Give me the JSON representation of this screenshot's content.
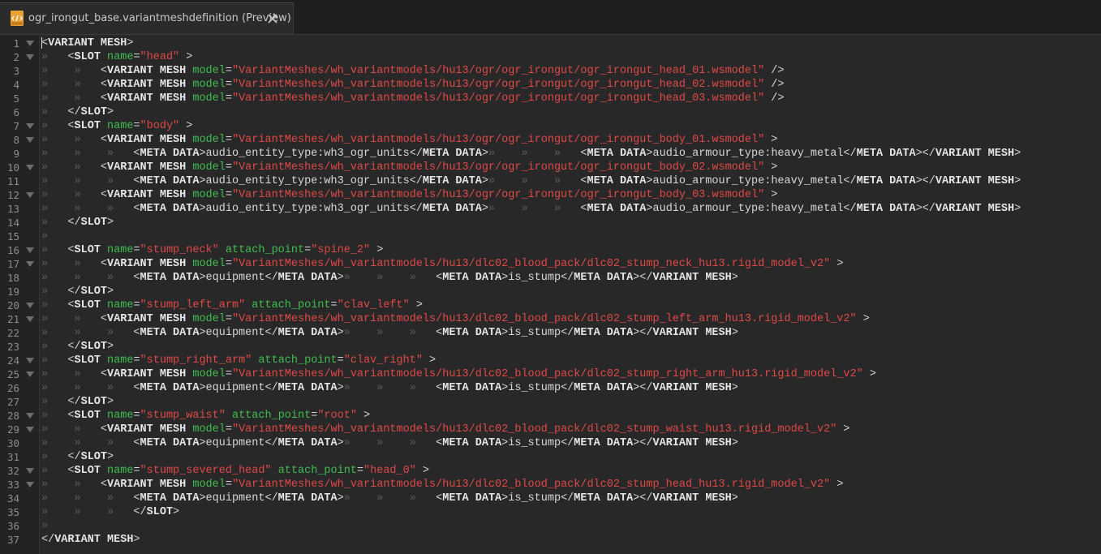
{
  "tab": {
    "title": "ogr_irongut_base.variantmeshdefinition (Preview)",
    "close_icon": "pin-close-icon",
    "file_icon": "xml-file-icon"
  },
  "colors": {
    "tag": "#e6e6e6",
    "attr": "#3fbe52",
    "string": "#e04848",
    "indent_marker": "#5c5c5c",
    "line_number": "#8c8c8c"
  },
  "lines": [
    {
      "n": "1",
      "fold": true,
      "indent": 0,
      "segs": [
        [
          "p",
          "<"
        ],
        [
          "t",
          "VARIANT MESH"
        ],
        [
          "p",
          ">"
        ]
      ]
    },
    {
      "n": "2",
      "fold": true,
      "indent": 1,
      "segs": [
        [
          "p",
          "<"
        ],
        [
          "t",
          "SLOT "
        ],
        [
          "a",
          "name"
        ],
        [
          "p",
          "="
        ],
        [
          "s",
          "\"head\""
        ],
        [
          "p",
          " >"
        ]
      ]
    },
    {
      "n": "3",
      "fold": false,
      "indent": 2,
      "segs": [
        [
          "p",
          "<"
        ],
        [
          "t",
          "VARIANT MESH "
        ],
        [
          "a",
          "model"
        ],
        [
          "p",
          "="
        ],
        [
          "s",
          "\"VariantMeshes/wh_variantmodels/hu13/ogr/ogr_irongut/ogr_irongut_head_01.wsmodel\""
        ],
        [
          "p",
          " />"
        ]
      ]
    },
    {
      "n": "4",
      "fold": false,
      "indent": 2,
      "segs": [
        [
          "p",
          "<"
        ],
        [
          "t",
          "VARIANT MESH "
        ],
        [
          "a",
          "model"
        ],
        [
          "p",
          "="
        ],
        [
          "s",
          "\"VariantMeshes/wh_variantmodels/hu13/ogr/ogr_irongut/ogr_irongut_head_02.wsmodel\""
        ],
        [
          "p",
          " />"
        ]
      ]
    },
    {
      "n": "5",
      "fold": false,
      "indent": 2,
      "segs": [
        [
          "p",
          "<"
        ],
        [
          "t",
          "VARIANT MESH "
        ],
        [
          "a",
          "model"
        ],
        [
          "p",
          "="
        ],
        [
          "s",
          "\"VariantMeshes/wh_variantmodels/hu13/ogr/ogr_irongut/ogr_irongut_head_03.wsmodel\""
        ],
        [
          "p",
          " />"
        ]
      ]
    },
    {
      "n": "6",
      "fold": false,
      "indent": 1,
      "segs": [
        [
          "p",
          "</"
        ],
        [
          "t",
          "SLOT"
        ],
        [
          "p",
          ">"
        ]
      ]
    },
    {
      "n": "7",
      "fold": true,
      "indent": 1,
      "segs": [
        [
          "p",
          "<"
        ],
        [
          "t",
          "SLOT "
        ],
        [
          "a",
          "name"
        ],
        [
          "p",
          "="
        ],
        [
          "s",
          "\"body\""
        ],
        [
          "p",
          " >"
        ]
      ]
    },
    {
      "n": "8",
      "fold": true,
      "indent": 2,
      "segs": [
        [
          "p",
          "<"
        ],
        [
          "t",
          "VARIANT MESH "
        ],
        [
          "a",
          "model"
        ],
        [
          "p",
          "="
        ],
        [
          "s",
          "\"VariantMeshes/wh_variantmodels/hu13/ogr/ogr_irongut/ogr_irongut_body_01.wsmodel\""
        ],
        [
          "p",
          " >"
        ]
      ]
    },
    {
      "n": "9",
      "fold": false,
      "indent": 3,
      "segs": [
        [
          "p",
          "<"
        ],
        [
          "t",
          "META DATA"
        ],
        [
          "p",
          ">audio_entity_type:wh3_ogr_units</"
        ],
        [
          "t",
          "META DATA"
        ],
        [
          "p",
          ">"
        ],
        [
          "ind",
          "»    »    »   "
        ],
        [
          "p",
          "<"
        ],
        [
          "t",
          "META DATA"
        ],
        [
          "p",
          ">audio_armour_type:heavy_metal</"
        ],
        [
          "t",
          "META DATA"
        ],
        [
          "p",
          "></"
        ],
        [
          "t",
          "VARIANT MESH"
        ],
        [
          "p",
          ">"
        ]
      ]
    },
    {
      "n": "10",
      "fold": true,
      "indent": 2,
      "segs": [
        [
          "p",
          "<"
        ],
        [
          "t",
          "VARIANT MESH "
        ],
        [
          "a",
          "model"
        ],
        [
          "p",
          "="
        ],
        [
          "s",
          "\"VariantMeshes/wh_variantmodels/hu13/ogr/ogr_irongut/ogr_irongut_body_02.wsmodel\""
        ],
        [
          "p",
          " >"
        ]
      ]
    },
    {
      "n": "11",
      "fold": false,
      "indent": 3,
      "segs": [
        [
          "p",
          "<"
        ],
        [
          "t",
          "META DATA"
        ],
        [
          "p",
          ">audio_entity_type:wh3_ogr_units</"
        ],
        [
          "t",
          "META DATA"
        ],
        [
          "p",
          ">"
        ],
        [
          "ind",
          "»    »    »   "
        ],
        [
          "p",
          "<"
        ],
        [
          "t",
          "META DATA"
        ],
        [
          "p",
          ">audio_armour_type:heavy_metal</"
        ],
        [
          "t",
          "META DATA"
        ],
        [
          "p",
          "></"
        ],
        [
          "t",
          "VARIANT MESH"
        ],
        [
          "p",
          ">"
        ]
      ]
    },
    {
      "n": "12",
      "fold": true,
      "indent": 2,
      "segs": [
        [
          "p",
          "<"
        ],
        [
          "t",
          "VARIANT MESH "
        ],
        [
          "a",
          "model"
        ],
        [
          "p",
          "="
        ],
        [
          "s",
          "\"VariantMeshes/wh_variantmodels/hu13/ogr/ogr_irongut/ogr_irongut_body_03.wsmodel\""
        ],
        [
          "p",
          " >"
        ]
      ]
    },
    {
      "n": "13",
      "fold": false,
      "indent": 3,
      "segs": [
        [
          "p",
          "<"
        ],
        [
          "t",
          "META DATA"
        ],
        [
          "p",
          ">audio_entity_type:wh3_ogr_units</"
        ],
        [
          "t",
          "META DATA"
        ],
        [
          "p",
          ">"
        ],
        [
          "ind",
          "»    »    »   "
        ],
        [
          "p",
          "<"
        ],
        [
          "t",
          "META DATA"
        ],
        [
          "p",
          ">audio_armour_type:heavy_metal</"
        ],
        [
          "t",
          "META DATA"
        ],
        [
          "p",
          "></"
        ],
        [
          "t",
          "VARIANT MESH"
        ],
        [
          "p",
          ">"
        ]
      ]
    },
    {
      "n": "14",
      "fold": false,
      "indent": 1,
      "segs": [
        [
          "p",
          "</"
        ],
        [
          "t",
          "SLOT"
        ],
        [
          "p",
          ">"
        ]
      ]
    },
    {
      "n": "15",
      "fold": false,
      "indent": 1,
      "segs": []
    },
    {
      "n": "16",
      "fold": true,
      "indent": 1,
      "segs": [
        [
          "p",
          "<"
        ],
        [
          "t",
          "SLOT "
        ],
        [
          "a",
          "name"
        ],
        [
          "p",
          "="
        ],
        [
          "s",
          "\"stump_neck\""
        ],
        [
          "p",
          " "
        ],
        [
          "a",
          "attach_point"
        ],
        [
          "p",
          "="
        ],
        [
          "s",
          "\"spine_2\""
        ],
        [
          "p",
          " >"
        ]
      ]
    },
    {
      "n": "17",
      "fold": true,
      "indent": 2,
      "segs": [
        [
          "p",
          "<"
        ],
        [
          "t",
          "VARIANT MESH "
        ],
        [
          "a",
          "model"
        ],
        [
          "p",
          "="
        ],
        [
          "s",
          "\"VariantMeshes/wh_variantmodels/hu13/dlc02_blood_pack/dlc02_stump_neck_hu13.rigid_model_v2\""
        ],
        [
          "p",
          " >"
        ]
      ]
    },
    {
      "n": "18",
      "fold": false,
      "indent": 3,
      "segs": [
        [
          "p",
          "<"
        ],
        [
          "t",
          "META DATA"
        ],
        [
          "p",
          ">equipment</"
        ],
        [
          "t",
          "META DATA"
        ],
        [
          "p",
          ">"
        ],
        [
          "ind",
          "»    »    »   "
        ],
        [
          "p",
          "<"
        ],
        [
          "t",
          "META DATA"
        ],
        [
          "p",
          ">is_stump</"
        ],
        [
          "t",
          "META DATA"
        ],
        [
          "p",
          "></"
        ],
        [
          "t",
          "VARIANT MESH"
        ],
        [
          "p",
          ">"
        ]
      ]
    },
    {
      "n": "19",
      "fold": false,
      "indent": 1,
      "segs": [
        [
          "p",
          "</"
        ],
        [
          "t",
          "SLOT"
        ],
        [
          "p",
          ">"
        ]
      ]
    },
    {
      "n": "20",
      "fold": true,
      "indent": 1,
      "segs": [
        [
          "p",
          "<"
        ],
        [
          "t",
          "SLOT "
        ],
        [
          "a",
          "name"
        ],
        [
          "p",
          "="
        ],
        [
          "s",
          "\"stump_left_arm\""
        ],
        [
          "p",
          " "
        ],
        [
          "a",
          "attach_point"
        ],
        [
          "p",
          "="
        ],
        [
          "s",
          "\"clav_left\""
        ],
        [
          "p",
          " >"
        ]
      ]
    },
    {
      "n": "21",
      "fold": true,
      "indent": 2,
      "segs": [
        [
          "p",
          "<"
        ],
        [
          "t",
          "VARIANT MESH "
        ],
        [
          "a",
          "model"
        ],
        [
          "p",
          "="
        ],
        [
          "s",
          "\"VariantMeshes/wh_variantmodels/hu13/dlc02_blood_pack/dlc02_stump_left_arm_hu13.rigid_model_v2\""
        ],
        [
          "p",
          " >"
        ]
      ]
    },
    {
      "n": "22",
      "fold": false,
      "indent": 3,
      "segs": [
        [
          "p",
          "<"
        ],
        [
          "t",
          "META DATA"
        ],
        [
          "p",
          ">equipment</"
        ],
        [
          "t",
          "META DATA"
        ],
        [
          "p",
          ">"
        ],
        [
          "ind",
          "»    »    »   "
        ],
        [
          "p",
          "<"
        ],
        [
          "t",
          "META DATA"
        ],
        [
          "p",
          ">is_stump</"
        ],
        [
          "t",
          "META DATA"
        ],
        [
          "p",
          "></"
        ],
        [
          "t",
          "VARIANT MESH"
        ],
        [
          "p",
          ">"
        ]
      ]
    },
    {
      "n": "23",
      "fold": false,
      "indent": 1,
      "segs": [
        [
          "p",
          "</"
        ],
        [
          "t",
          "SLOT"
        ],
        [
          "p",
          ">"
        ]
      ]
    },
    {
      "n": "24",
      "fold": true,
      "indent": 1,
      "segs": [
        [
          "p",
          "<"
        ],
        [
          "t",
          "SLOT "
        ],
        [
          "a",
          "name"
        ],
        [
          "p",
          "="
        ],
        [
          "s",
          "\"stump_right_arm\""
        ],
        [
          "p",
          " "
        ],
        [
          "a",
          "attach_point"
        ],
        [
          "p",
          "="
        ],
        [
          "s",
          "\"clav_right\""
        ],
        [
          "p",
          " >"
        ]
      ]
    },
    {
      "n": "25",
      "fold": true,
      "indent": 2,
      "segs": [
        [
          "p",
          "<"
        ],
        [
          "t",
          "VARIANT MESH "
        ],
        [
          "a",
          "model"
        ],
        [
          "p",
          "="
        ],
        [
          "s",
          "\"VariantMeshes/wh_variantmodels/hu13/dlc02_blood_pack/dlc02_stump_right_arm_hu13.rigid_model_v2\""
        ],
        [
          "p",
          " >"
        ]
      ]
    },
    {
      "n": "26",
      "fold": false,
      "indent": 3,
      "segs": [
        [
          "p",
          "<"
        ],
        [
          "t",
          "META DATA"
        ],
        [
          "p",
          ">equipment</"
        ],
        [
          "t",
          "META DATA"
        ],
        [
          "p",
          ">"
        ],
        [
          "ind",
          "»    »    »   "
        ],
        [
          "p",
          "<"
        ],
        [
          "t",
          "META DATA"
        ],
        [
          "p",
          ">is_stump</"
        ],
        [
          "t",
          "META DATA"
        ],
        [
          "p",
          "></"
        ],
        [
          "t",
          "VARIANT MESH"
        ],
        [
          "p",
          ">"
        ]
      ]
    },
    {
      "n": "27",
      "fold": false,
      "indent": 1,
      "segs": [
        [
          "p",
          "</"
        ],
        [
          "t",
          "SLOT"
        ],
        [
          "p",
          ">"
        ]
      ]
    },
    {
      "n": "28",
      "fold": true,
      "indent": 1,
      "segs": [
        [
          "p",
          "<"
        ],
        [
          "t",
          "SLOT "
        ],
        [
          "a",
          "name"
        ],
        [
          "p",
          "="
        ],
        [
          "s",
          "\"stump_waist\""
        ],
        [
          "p",
          " "
        ],
        [
          "a",
          "attach_point"
        ],
        [
          "p",
          "="
        ],
        [
          "s",
          "\"root\""
        ],
        [
          "p",
          " >"
        ]
      ]
    },
    {
      "n": "29",
      "fold": true,
      "indent": 2,
      "segs": [
        [
          "p",
          "<"
        ],
        [
          "t",
          "VARIANT MESH "
        ],
        [
          "a",
          "model"
        ],
        [
          "p",
          "="
        ],
        [
          "s",
          "\"VariantMeshes/wh_variantmodels/hu13/dlc02_blood_pack/dlc02_stump_waist_hu13.rigid_model_v2\""
        ],
        [
          "p",
          " >"
        ]
      ]
    },
    {
      "n": "30",
      "fold": false,
      "indent": 3,
      "segs": [
        [
          "p",
          "<"
        ],
        [
          "t",
          "META DATA"
        ],
        [
          "p",
          ">equipment</"
        ],
        [
          "t",
          "META DATA"
        ],
        [
          "p",
          ">"
        ],
        [
          "ind",
          "»    »    »   "
        ],
        [
          "p",
          "<"
        ],
        [
          "t",
          "META DATA"
        ],
        [
          "p",
          ">is_stump</"
        ],
        [
          "t",
          "META DATA"
        ],
        [
          "p",
          "></"
        ],
        [
          "t",
          "VARIANT MESH"
        ],
        [
          "p",
          ">"
        ]
      ]
    },
    {
      "n": "31",
      "fold": false,
      "indent": 1,
      "segs": [
        [
          "p",
          "</"
        ],
        [
          "t",
          "SLOT"
        ],
        [
          "p",
          ">"
        ]
      ]
    },
    {
      "n": "32",
      "fold": true,
      "indent": 1,
      "segs": [
        [
          "p",
          "<"
        ],
        [
          "t",
          "SLOT "
        ],
        [
          "a",
          "name"
        ],
        [
          "p",
          "="
        ],
        [
          "s",
          "\"stump_severed_head\""
        ],
        [
          "p",
          " "
        ],
        [
          "a",
          "attach_point"
        ],
        [
          "p",
          "="
        ],
        [
          "s",
          "\"head_0\""
        ],
        [
          "p",
          " >"
        ]
      ]
    },
    {
      "n": "33",
      "fold": true,
      "indent": 2,
      "segs": [
        [
          "p",
          "<"
        ],
        [
          "t",
          "VARIANT MESH "
        ],
        [
          "a",
          "model"
        ],
        [
          "p",
          "="
        ],
        [
          "s",
          "\"VariantMeshes/wh_variantmodels/hu13/dlc02_blood_pack/dlc02_stump_head_hu13.rigid_model_v2\""
        ],
        [
          "p",
          " >"
        ]
      ]
    },
    {
      "n": "34",
      "fold": false,
      "indent": 3,
      "segs": [
        [
          "p",
          "<"
        ],
        [
          "t",
          "META DATA"
        ],
        [
          "p",
          ">equipment</"
        ],
        [
          "t",
          "META DATA"
        ],
        [
          "p",
          ">"
        ],
        [
          "ind",
          "»    »    »   "
        ],
        [
          "p",
          "<"
        ],
        [
          "t",
          "META DATA"
        ],
        [
          "p",
          ">is_stump</"
        ],
        [
          "t",
          "META DATA"
        ],
        [
          "p",
          "></"
        ],
        [
          "t",
          "VARIANT MESH"
        ],
        [
          "p",
          ">"
        ]
      ]
    },
    {
      "n": "35",
      "fold": false,
      "indent": 3,
      "segs": [
        [
          "p",
          "</"
        ],
        [
          "t",
          "SLOT"
        ],
        [
          "p",
          ">"
        ]
      ]
    },
    {
      "n": "36",
      "fold": false,
      "indent": 1,
      "segs": []
    },
    {
      "n": "37",
      "fold": false,
      "indent": 0,
      "segs": [
        [
          "p",
          "</"
        ],
        [
          "t",
          "VARIANT MESH"
        ],
        [
          "p",
          ">"
        ]
      ]
    }
  ]
}
